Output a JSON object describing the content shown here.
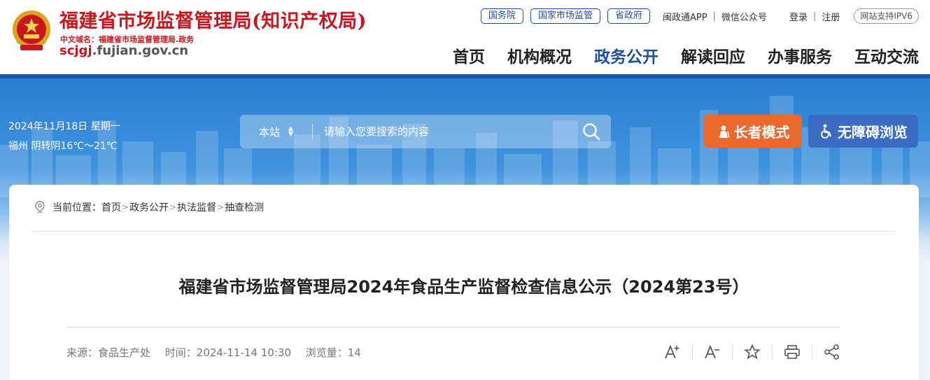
{
  "header": {
    "site_name": "福建省市场监督管理局(知识产权局)",
    "cn_domain": "中文域名：福建省市场监督管理局.政务",
    "url_prefix": "scjgj",
    "url_suffix": ".fujian.gov.cn",
    "top_links": {
      "guowuyuan": "国务院",
      "guojia": "国家市场监管",
      "shengzhengfu": "省政府",
      "app": "闽政通APP",
      "wechat": "微信公众号",
      "login": "登录",
      "register": "注册",
      "ipv6": "网站支持IPV6"
    },
    "nav": [
      "首页",
      "机构概况",
      "政务公开",
      "解读回应",
      "办事服务",
      "互动交流"
    ],
    "active_nav": "政务公开"
  },
  "banner": {
    "date": "2024年11月18日 星期一",
    "weather": "福州 阴转阴16℃～21℃",
    "search_scope": "本站",
    "search_placeholder": "请输入您要搜索的内容",
    "elder_mode": "长者模式",
    "accessibility": "无障碍浏览"
  },
  "breadcrumb": {
    "prefix": "当前位置：",
    "items": [
      "首页",
      "政务公开",
      "执法监督",
      "抽查检测"
    ]
  },
  "article": {
    "title": "福建省市场监督管理局2024年食品生产监督检查信息公示（2024第23号）",
    "source": "来源：食品生产处",
    "time": "时间：2024-11-14 10:30",
    "views": "浏览量：14"
  },
  "colors": {
    "brand_red": "#c8161d",
    "brand_blue": "#1d4f9c",
    "elder_orange": "#e96a2c",
    "a11y_blue": "#3a6cc2"
  },
  "icons": {
    "emblem": "national-emblem-icon",
    "search": "search-icon",
    "elder": "elder-person-icon",
    "a11y": "wheelchair-icon",
    "location": "location-pin-icon",
    "font_up": "font-increase-icon",
    "font_down": "font-decrease-icon",
    "favorite": "star-icon",
    "print": "printer-icon",
    "share": "share-icon"
  }
}
